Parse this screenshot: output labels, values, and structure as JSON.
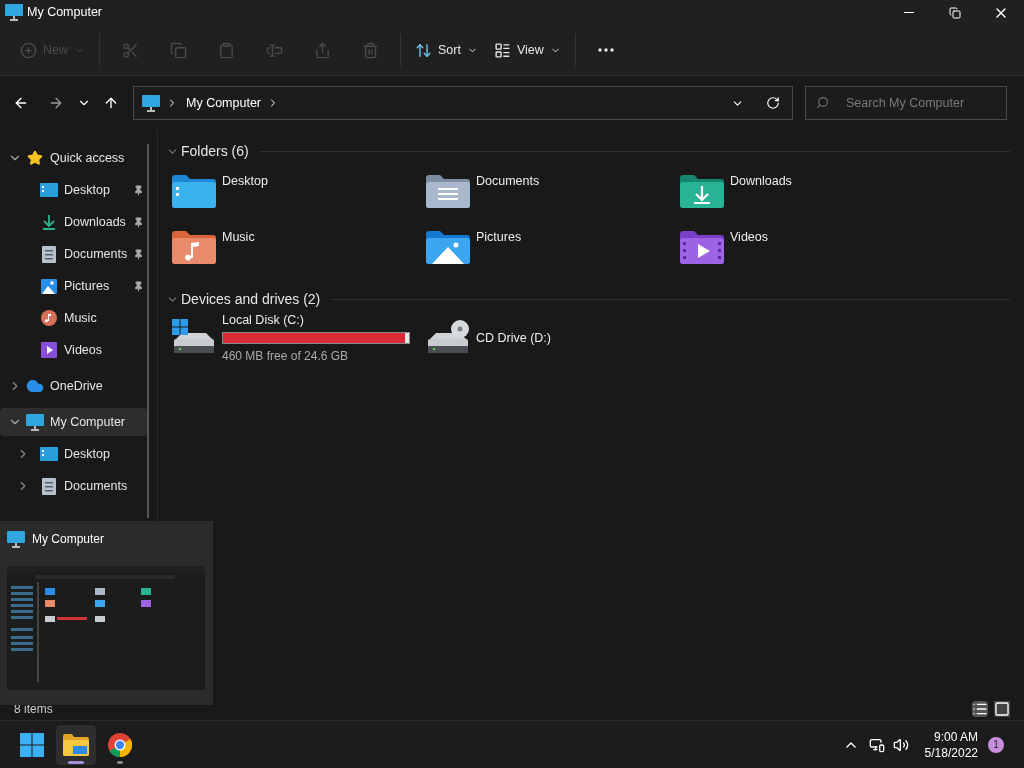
{
  "window": {
    "title": "My Computer"
  },
  "toolbar": [
    {
      "kind": "new",
      "label": "New",
      "disabled": true
    },
    {
      "kind": "cut",
      "disabled": true
    },
    {
      "kind": "copy",
      "disabled": true
    },
    {
      "kind": "paste",
      "disabled": true
    },
    {
      "kind": "rename",
      "disabled": true
    },
    {
      "kind": "share",
      "disabled": true
    },
    {
      "kind": "delete",
      "disabled": true
    },
    {
      "kind": "sort",
      "label": "Sort",
      "disabled": false
    },
    {
      "kind": "view",
      "label": "View",
      "disabled": false
    },
    {
      "kind": "more",
      "disabled": false
    }
  ],
  "address": {
    "path": "My Computer"
  },
  "search": {
    "placeholder": "Search My Computer"
  },
  "sidebar": {
    "items": [
      {
        "kind": "star",
        "label": "Quick access",
        "expanded": true,
        "selected": false,
        "children": [
          {
            "kind": "desktop",
            "label": "Desktop",
            "pinned": true
          },
          {
            "kind": "downloads",
            "label": "Downloads",
            "pinned": true
          },
          {
            "kind": "documents",
            "label": "Documents",
            "pinned": true
          },
          {
            "kind": "pictures",
            "label": "Pictures",
            "pinned": true
          },
          {
            "kind": "music",
            "label": "Music",
            "pinned": false
          },
          {
            "kind": "videos",
            "label": "Videos",
            "pinned": false
          }
        ]
      },
      {
        "kind": "cloud",
        "label": "OneDrive",
        "expanded": false,
        "selected": false
      },
      {
        "kind": "computer",
        "label": "My Computer",
        "expanded": true,
        "selected": true,
        "children": [
          {
            "kind": "desktop",
            "label": "Desktop",
            "expanded": false
          },
          {
            "kind": "documents",
            "label": "Documents",
            "expanded": false
          }
        ]
      }
    ]
  },
  "sections": [
    {
      "title": "Folders (6)",
      "expanded": true,
      "kind": "folders",
      "items": [
        {
          "kind": "desktop",
          "label": "Desktop"
        },
        {
          "kind": "documents",
          "label": "Documents"
        },
        {
          "kind": "downloads",
          "label": "Downloads"
        },
        {
          "kind": "music",
          "label": "Music"
        },
        {
          "kind": "pictures",
          "label": "Pictures"
        },
        {
          "kind": "videos",
          "label": "Videos"
        }
      ]
    },
    {
      "title": "Devices and drives (2)",
      "expanded": true,
      "kind": "drives",
      "items": [
        {
          "kind": "disk",
          "label": "Local Disk (C:)",
          "level": 0.98,
          "detail": "460 MB free of 24.6 GB"
        },
        {
          "kind": "cd",
          "label": "CD Drive (D:)"
        }
      ]
    }
  ],
  "status_bar": {
    "text": "8 items"
  },
  "preview": {
    "title": "My Computer"
  },
  "taskbar": {
    "apps": [
      {
        "kind": "start",
        "selected": false,
        "running": false
      },
      {
        "kind": "explorer",
        "selected": true,
        "running": true
      },
      {
        "kind": "chrome",
        "selected": false,
        "running": true
      }
    ],
    "time": "9:00 AM",
    "date": "5/18/2022",
    "notifications": "1"
  }
}
